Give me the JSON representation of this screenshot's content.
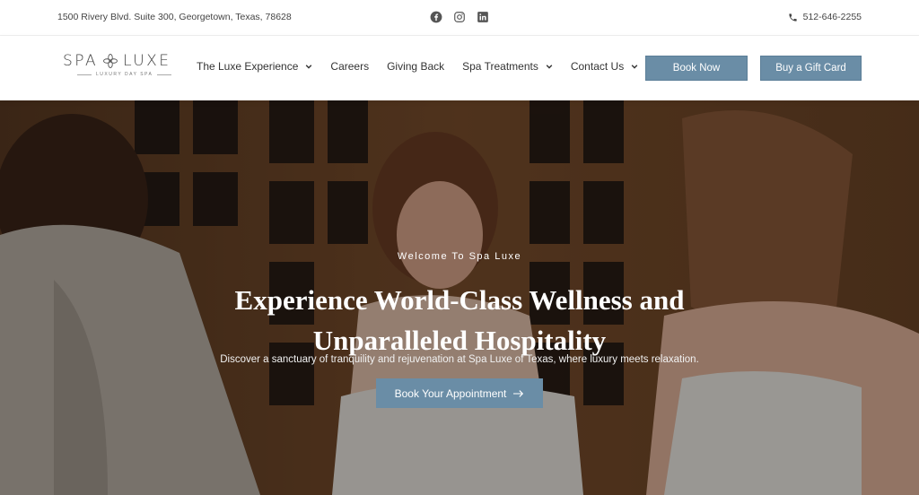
{
  "topbar": {
    "address": "1500 Rivery Blvd. Suite 300, Georgetown, Texas, 78628",
    "phone": "512-646-2255",
    "socials": [
      "facebook-icon",
      "instagram-icon",
      "linkedin-icon"
    ]
  },
  "logo": {
    "brand_left": "SPA",
    "brand_right": "LUXE",
    "tagline": "LUXURY DAY SPA"
  },
  "nav": {
    "items": [
      {
        "label": "The Luxe Experience",
        "has_dropdown": true
      },
      {
        "label": "Careers",
        "has_dropdown": false
      },
      {
        "label": "Giving Back",
        "has_dropdown": false
      },
      {
        "label": "Spa Treatments",
        "has_dropdown": true
      },
      {
        "label": "Contact Us",
        "has_dropdown": true
      }
    ],
    "book_now": "Book Now",
    "gift_card": "Buy a Gift Card"
  },
  "hero": {
    "eyebrow": "Welcome To Spa Luxe",
    "headline": "Experience World-Class Wellness and Unparalleled Hospitality",
    "subtext": "Discover a sanctuary of tranquility and rejuvenation at Spa Luxe of Texas, where luxury meets relaxation.",
    "cta": "Book Your Appointment"
  },
  "colors": {
    "accent": "#6a8da6",
    "text": "#333333"
  }
}
